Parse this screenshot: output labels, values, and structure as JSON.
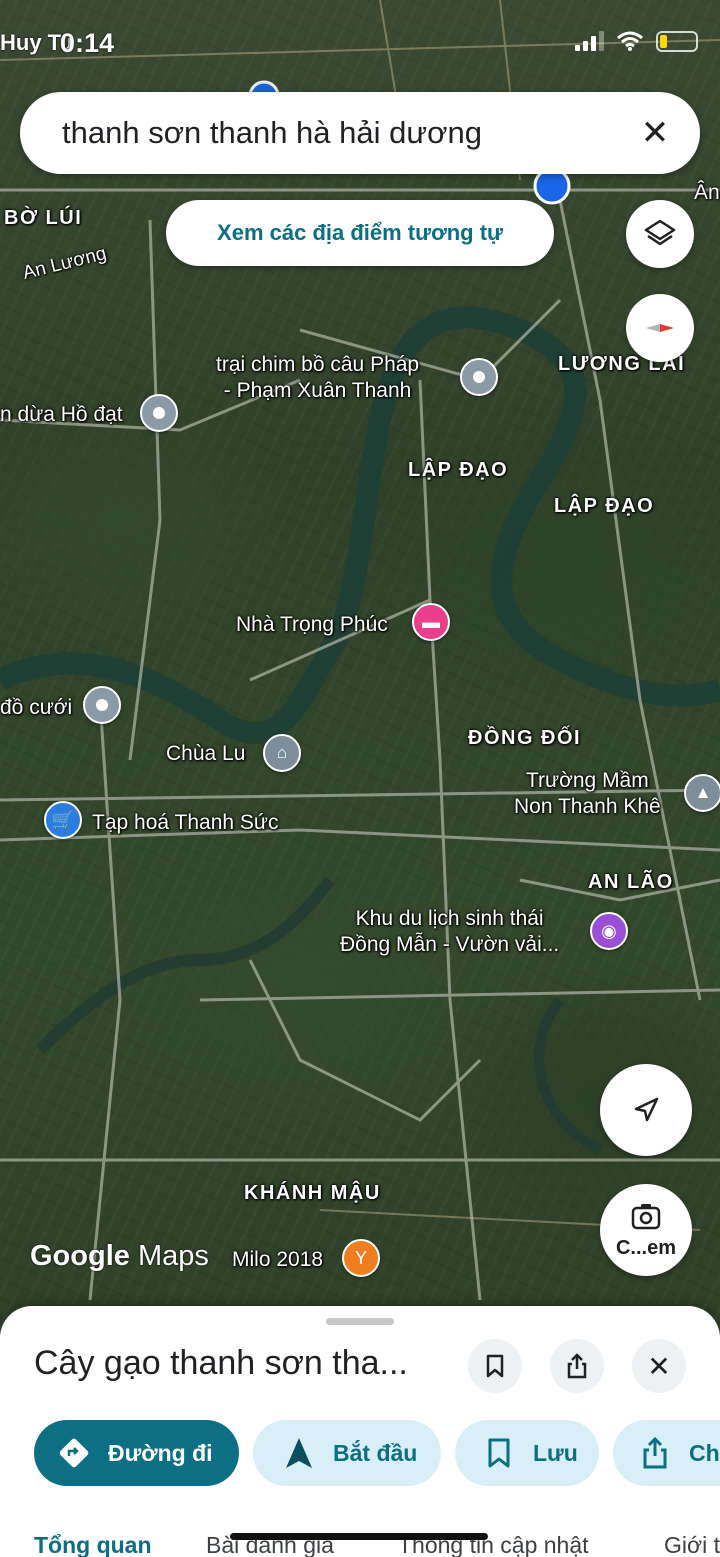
{
  "status_bar": {
    "carrier": "Huy Tu",
    "time": "0:14",
    "battery_level": 0.2
  },
  "search": {
    "query": "thanh sơn thanh hà hải dương",
    "close_icon": "✕"
  },
  "similar_places_label": "Xem các địa điểm tương tự",
  "map": {
    "area_labels": [
      "BỜ LÚI",
      "An Lương",
      "LƯƠNG LÀI",
      "LẬP ĐẠO",
      "LẬP ĐẠO",
      "ĐỒNG ĐỐI",
      "AN LÃO",
      "KHÁNH MẬU",
      "Ân"
    ],
    "places": [
      {
        "name": "trại chim bồ câu Pháp - Phạm Xuân Thanh",
        "line1": "trại chim bồ câu Pháp",
        "line2": "- Phạm Xuân Thanh"
      },
      {
        "name": "n dừa Hồ đạt"
      },
      {
        "name": "Nhà Trọng Phúc"
      },
      {
        "name": "đồ cưới"
      },
      {
        "name": "Chùa Lu"
      },
      {
        "name": "Tạp hoá Thanh Sức"
      },
      {
        "name": "Trường Mầm Non Thanh Khê",
        "line1": "Trường Mầm",
        "line2": "Non Thanh Khê"
      },
      {
        "name": "Khu du lịch sinh thái Đồng Mẫn - Vườn vải...",
        "line1": "Khu du lịch sinh thái",
        "line2": "Đồng Mẫn - Vườn vải..."
      },
      {
        "name": "Milo 2018"
      }
    ]
  },
  "controls": {
    "camera_label": "C...em"
  },
  "branding": {
    "google": "Google",
    "maps": "Maps"
  },
  "sheet": {
    "title": "Cây gạo thanh sơn tha...",
    "actions": [
      {
        "label": "Đường đi"
      },
      {
        "label": "Bắt đầu"
      },
      {
        "label": "Lưu"
      },
      {
        "label": "Ch"
      }
    ],
    "tabs": [
      "Tổng quan",
      "Bài đánh giá",
      "Thông tin cập nhật",
      "Giới t"
    ]
  },
  "colors": {
    "accent": "#0d6f84",
    "accent_light": "#d8eff7",
    "location_dot": "#1a66e8"
  }
}
